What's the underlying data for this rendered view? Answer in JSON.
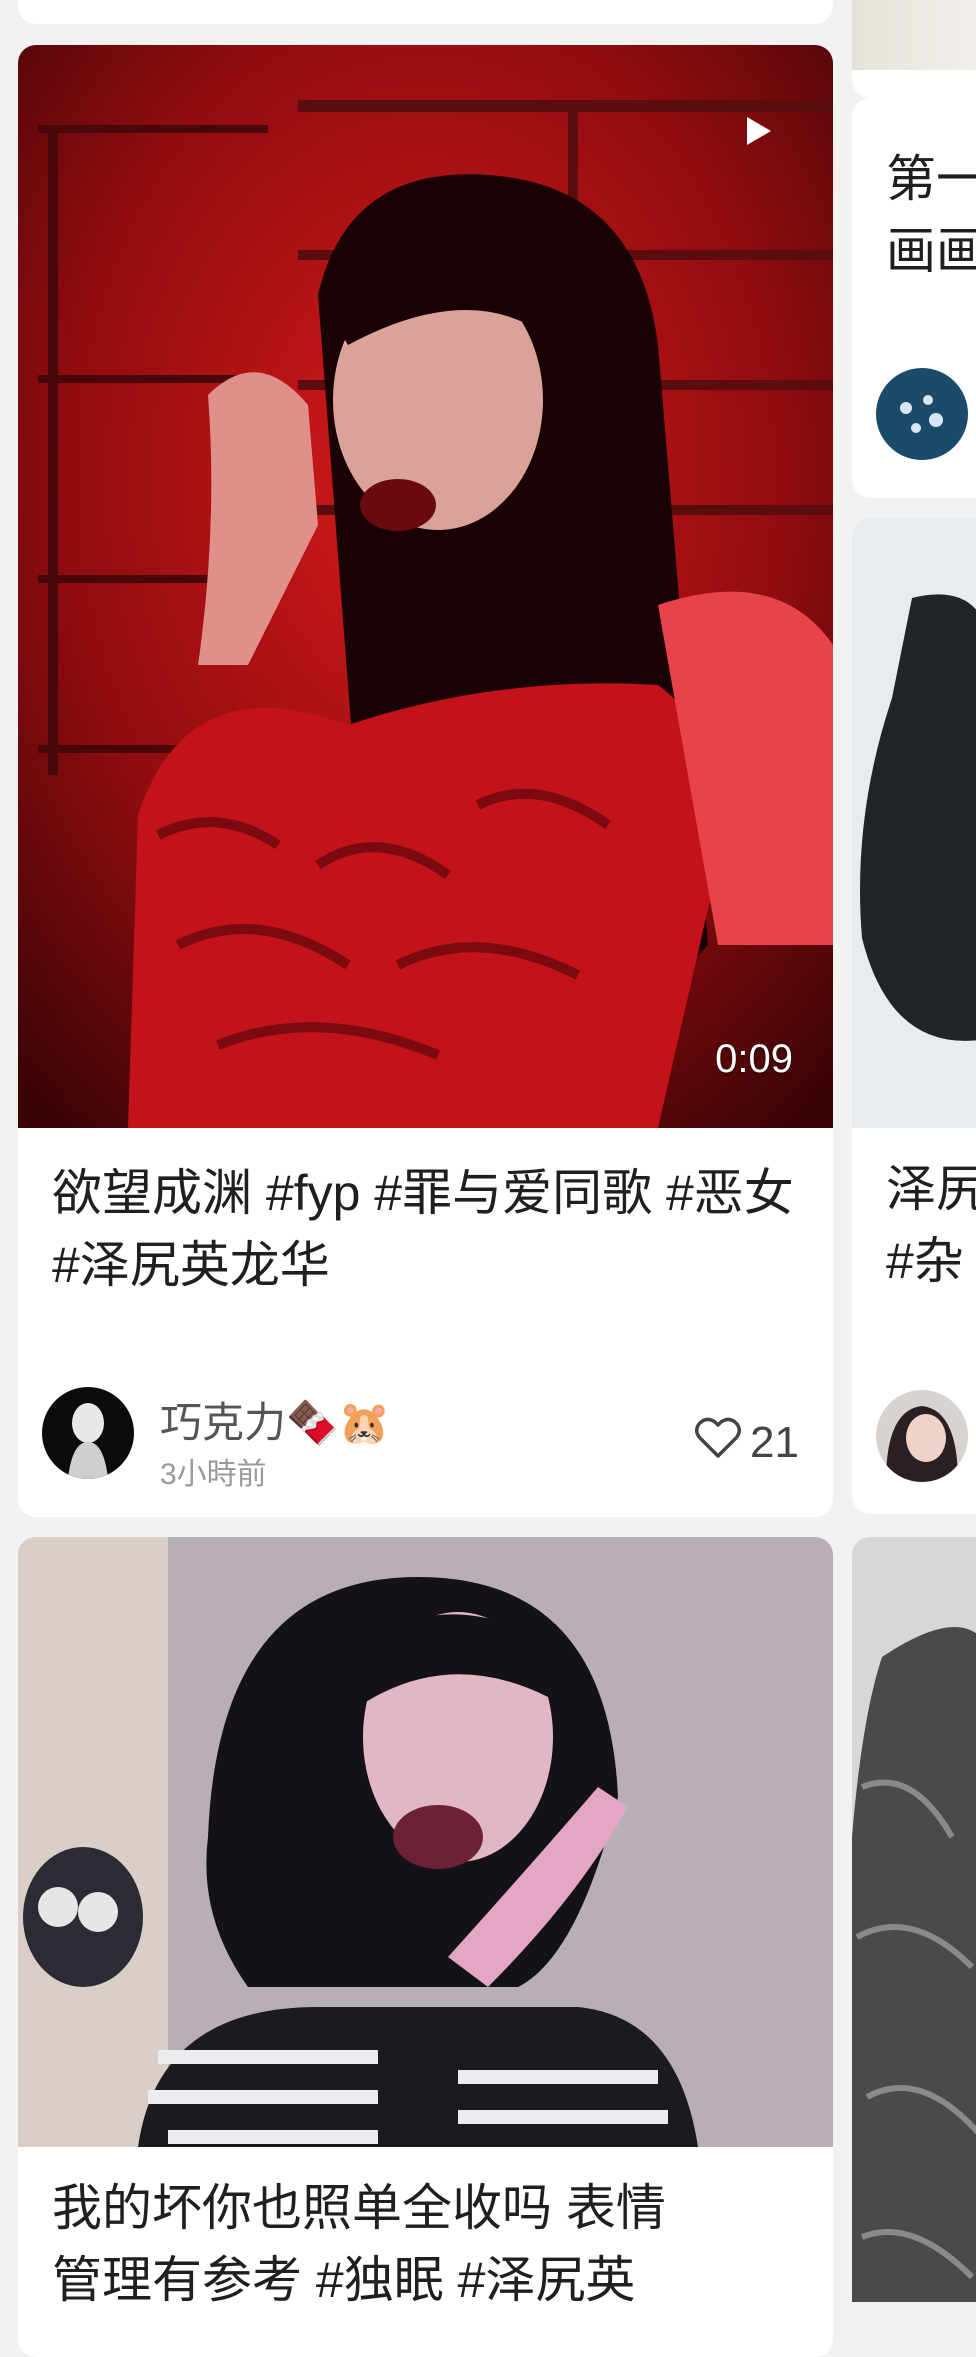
{
  "feed": {
    "cards": [
      {
        "title": "欲望成渊 #fyp  #罪与爱同歌 #恶女  #泽尻英龙华",
        "author": "巧克力🍫🐹",
        "time": "3小時前",
        "likes": "21",
        "duration": "0:09",
        "media": "video"
      },
      {
        "title": "我的坏你也照单全收吗 表情",
        "title_line2": "管理有参考 #独眠 #泽尻英",
        "media": "image"
      }
    ],
    "right_column_fragments": {
      "card1_title_line1": "第一",
      "card1_title_line2": "画画",
      "card2_title_line1": "泽尻",
      "card2_title_line2": "#杂"
    }
  },
  "icons": {
    "play": "play-icon",
    "heart": "heart-icon"
  },
  "colors": {
    "background": "#f2f2f2",
    "card": "#ffffff",
    "text": "#1f1f1f",
    "secondary": "#9a9a9a"
  }
}
